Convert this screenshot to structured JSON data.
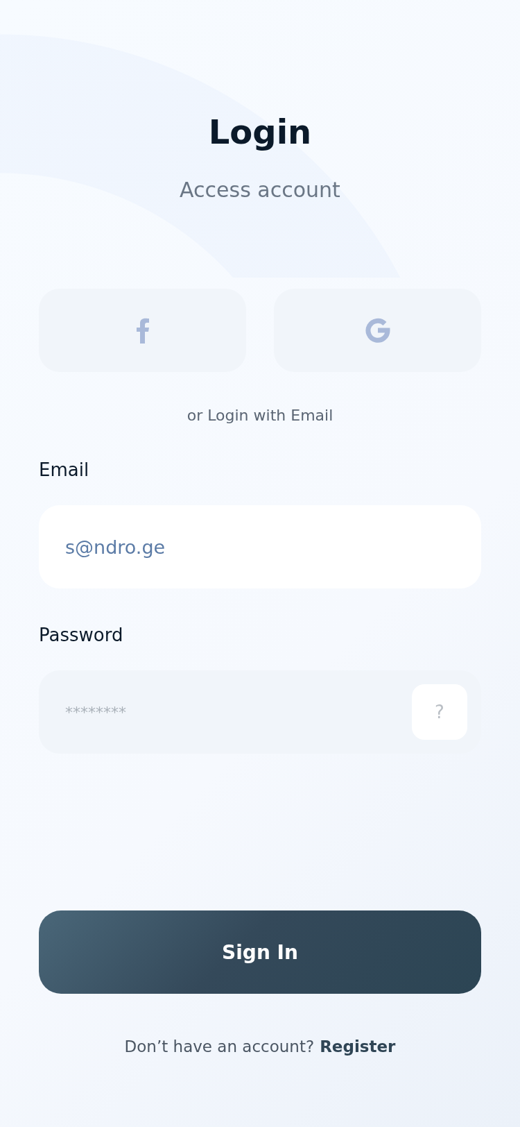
{
  "header": {
    "title": "Login",
    "subtitle": "Access account"
  },
  "social_buttons": [
    {
      "kind": "facebook"
    },
    {
      "kind": "google"
    }
  ],
  "divider_text": "or Login with Email",
  "fields": [
    {
      "kind": "text",
      "label": "Email",
      "value": "s@ndro.ge"
    },
    {
      "kind": "password",
      "label": "Password",
      "placeholder": "********",
      "help_button": "?"
    }
  ],
  "sign_in_button": "Sign In",
  "footer": {
    "text": "Don’t have an account?",
    "link": "Register"
  }
}
